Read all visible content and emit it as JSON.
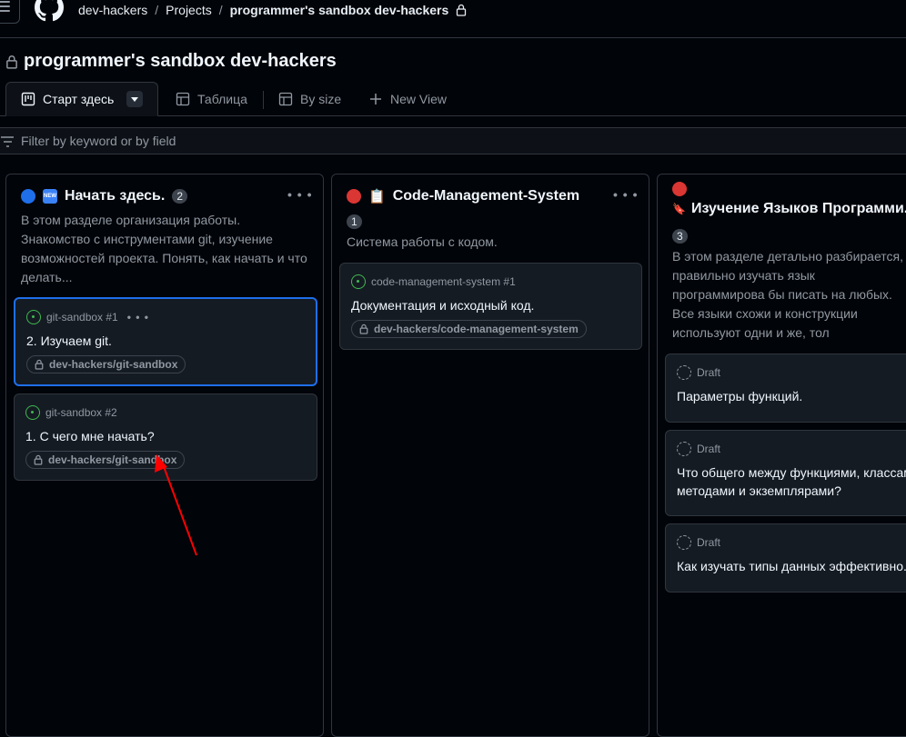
{
  "breadcrumb": {
    "org": "dev-hackers",
    "sep1": "/",
    "projects": "Projects",
    "sep2": "/",
    "project": "programmer's sandbox dev-hackers"
  },
  "project_title": "programmer's sandbox dev-hackers",
  "views": [
    {
      "label": "Старт здесь",
      "icon": "board-icon",
      "active": true
    },
    {
      "label": "Таблица",
      "icon": "table-icon"
    },
    {
      "label": "By size",
      "icon": "table-icon"
    },
    {
      "label": "New View",
      "icon": "plus-icon"
    }
  ],
  "filter": {
    "placeholder": "Filter by keyword or by field"
  },
  "columns": [
    {
      "emoji": "🆕",
      "title": "Начать здесь.",
      "count": "2",
      "color": "#1f6feb",
      "description": "В этом разделе организация работы. Знакомство с инструментами git, изучение возможностей проекта. Понять, как начать и что делать...",
      "cards": [
        {
          "ref": "git-sandbox #1",
          "title": "2. Изучаем git.",
          "repo": "dev-hackers/git-sandbox",
          "selected": true,
          "menu": "• • •"
        },
        {
          "ref": "git-sandbox #2",
          "title": "1. С чего мне начать?",
          "repo": "dev-hackers/git-sandbox"
        }
      ]
    },
    {
      "emoji": "📋",
      "title": "Code-Management-System",
      "count": "1",
      "color": "#da3633",
      "description": "Система работы с кодом.",
      "cards": [
        {
          "ref": "code-management-system #1",
          "title": "Документация и исходный код.",
          "repo": "dev-hackers/code-management-system"
        }
      ]
    },
    {
      "emoji": "🔖",
      "title": "Изучение Языков Программи...",
      "count": "3",
      "color": "#da3633",
      "description": "В этом разделе детально разбирается, правильно изучать язык программирова бы писать на любых. Все языки схожи и конструкции используют одни и же, тол записываются по разному.",
      "cards": [
        {
          "ref": "Draft",
          "title": "Параметры функций."
        },
        {
          "ref": "Draft",
          "title": "Что общего между функциями, классам методами и экземплярами?"
        },
        {
          "ref": "Draft",
          "title": "Как изучать типы данных эффективно."
        }
      ]
    }
  ],
  "column_menu": "• • •",
  "colors": {
    "accent": "#1f6feb",
    "open": "#3fb950",
    "red": "#da3633",
    "annotation_arrow": "#ff0000"
  }
}
